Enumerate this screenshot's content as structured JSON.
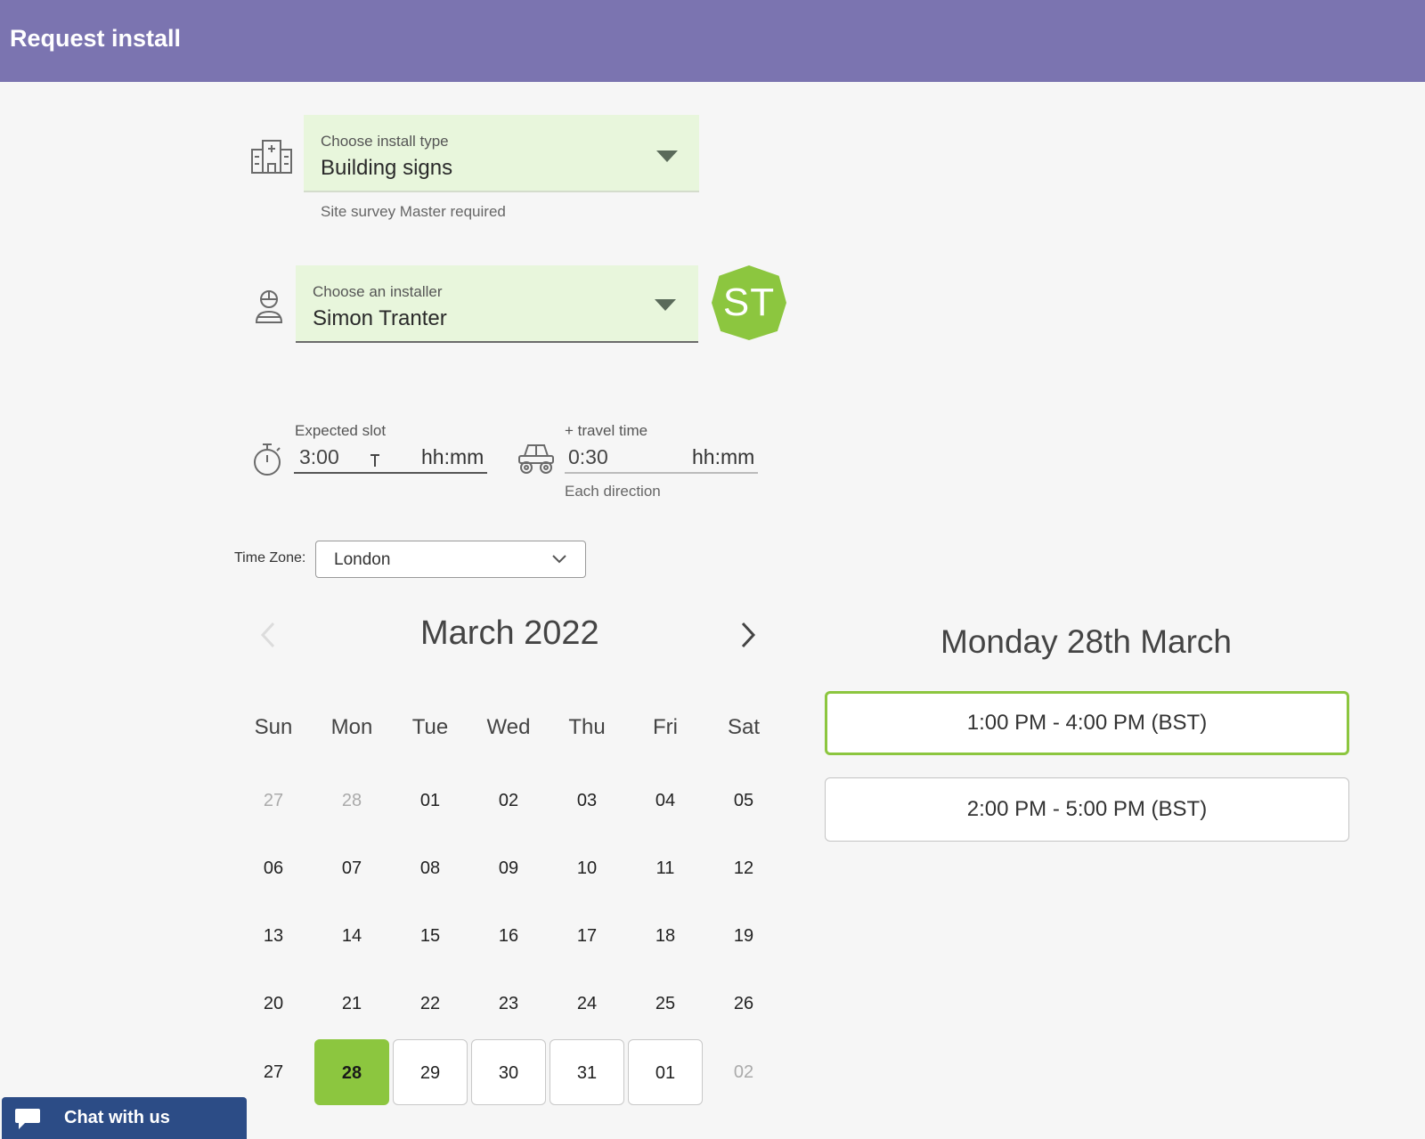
{
  "header": {
    "title": "Request install"
  },
  "install_type": {
    "label": "Choose install type",
    "value": "Building signs",
    "helper": "Site survey Master required"
  },
  "installer": {
    "label": "Choose an installer",
    "value": "Simon Tranter",
    "initials": "ST"
  },
  "expected_slot": {
    "label": "Expected slot",
    "value": "3:00",
    "unit": "hh:mm"
  },
  "travel_time": {
    "label": "+ travel time",
    "value": "0:30",
    "unit": "hh:mm",
    "helper": "Each direction"
  },
  "timezone": {
    "label": "Time Zone:",
    "value": "London"
  },
  "calendar": {
    "month_title": "March 2022",
    "weekdays": [
      "Sun",
      "Mon",
      "Tue",
      "Wed",
      "Thu",
      "Fri",
      "Sat"
    ],
    "weeks": [
      [
        "27",
        "28",
        "01",
        "02",
        "03",
        "04",
        "05"
      ],
      [
        "06",
        "07",
        "08",
        "09",
        "10",
        "11",
        "12"
      ],
      [
        "13",
        "14",
        "15",
        "16",
        "17",
        "18",
        "19"
      ],
      [
        "20",
        "21",
        "22",
        "23",
        "24",
        "25",
        "26"
      ],
      [
        "27",
        "28",
        "29",
        "30",
        "31",
        "01",
        "02"
      ]
    ],
    "selected": "28"
  },
  "slots": {
    "heading": "Monday 28th March",
    "items": [
      "1:00 PM - 4:00 PM (BST)",
      "2:00 PM - 5:00 PM (BST)"
    ]
  },
  "chat": {
    "label": "Chat with us"
  },
  "colors": {
    "header": "#7b74b0",
    "accent": "#8cc63f",
    "field_bg": "#e8f6dc",
    "chat": "#2c4c86"
  }
}
